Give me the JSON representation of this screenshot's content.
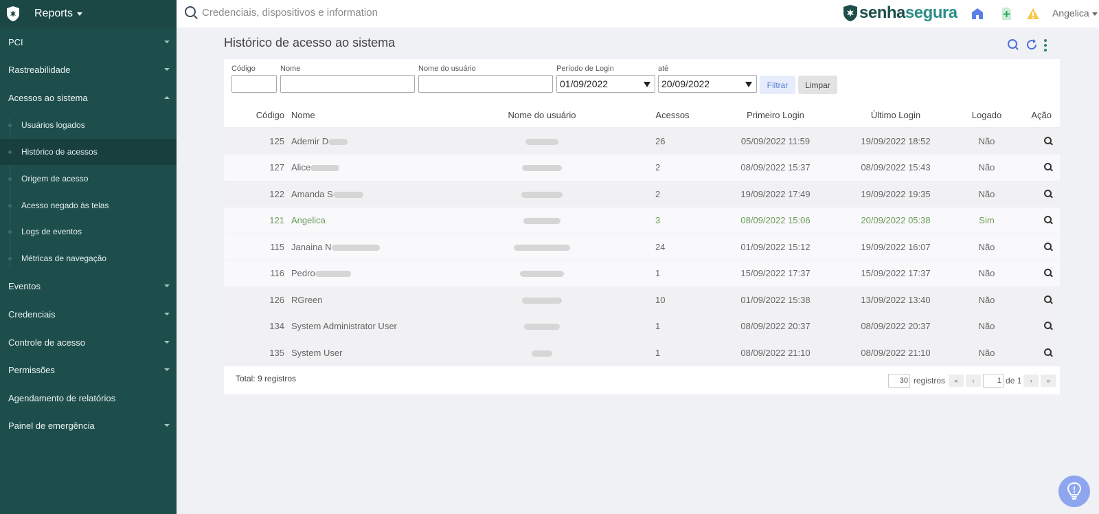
{
  "sidebar": {
    "title": "Reports",
    "menu": [
      {
        "label": "PCI"
      },
      {
        "label": "Rastreabilidade"
      },
      {
        "label": "Acessos ao sistema"
      },
      {
        "label": "Eventos"
      },
      {
        "label": "Credenciais"
      },
      {
        "label": "Controle de acesso"
      },
      {
        "label": "Permissões"
      },
      {
        "label": "Agendamento de relatórios"
      },
      {
        "label": "Painel de emergência"
      }
    ],
    "submenu": [
      {
        "label": "Usuários logados"
      },
      {
        "label": "Histórico de acessos"
      },
      {
        "label": "Origem de acesso"
      },
      {
        "label": "Acesso negado às telas"
      },
      {
        "label": "Logs de eventos"
      },
      {
        "label": "Métricas de navegação"
      }
    ]
  },
  "topbar": {
    "search_placeholder": "Credenciais, dispositivos e information",
    "brand_part1": "senha",
    "brand_part2": "segura",
    "user": "Angelica"
  },
  "page": {
    "title": "Histórico de acesso ao sistema"
  },
  "filters": {
    "code_label": "Código",
    "name_label": "Nome",
    "username_label": "Nome do usuário",
    "period_label": "Período de Login",
    "until_label": "até",
    "period_from": "01/09/2022",
    "period_to": "20/09/2022",
    "filter_button": "Filtrar",
    "clear_button": "Limpar"
  },
  "table": {
    "headers": {
      "code": "Código",
      "name": "Nome",
      "username": "Nome do usuário",
      "accesses": "Acessos",
      "first_login": "Primeiro Login",
      "last_login": "Último Login",
      "logged": "Logado",
      "action": "Ação"
    },
    "rows": [
      {
        "code": "125",
        "name": "Ademir D",
        "accesses": "26",
        "first": "05/09/2022 11:59",
        "last": "19/09/2022 18:52",
        "logged": "Não"
      },
      {
        "code": "127",
        "name": "Alice",
        "accesses": "2",
        "first": "08/09/2022 15:37",
        "last": "08/09/2022 15:43",
        "logged": "Não"
      },
      {
        "code": "122",
        "name": "Amanda S",
        "accesses": "2",
        "first": "19/09/2022 17:49",
        "last": "19/09/2022 19:35",
        "logged": "Não"
      },
      {
        "code": "121",
        "name": "Angelica",
        "accesses": "3",
        "first": "08/09/2022 15:06",
        "last": "20/09/2022 05:38",
        "logged": "Sim"
      },
      {
        "code": "115",
        "name": "Janaina N",
        "accesses": "24",
        "first": "01/09/2022 15:12",
        "last": "19/09/2022 16:07",
        "logged": "Não"
      },
      {
        "code": "116",
        "name": "Pedro",
        "accesses": "1",
        "first": "15/09/2022 17:37",
        "last": "15/09/2022 17:37",
        "logged": "Não"
      },
      {
        "code": "126",
        "name": "RGreen",
        "accesses": "10",
        "first": "01/09/2022 15:38",
        "last": "13/09/2022 13:40",
        "logged": "Não"
      },
      {
        "code": "134",
        "name": "System Administrator User",
        "accesses": "1",
        "first": "08/09/2022 20:37",
        "last": "08/09/2022 20:37",
        "logged": "Não"
      },
      {
        "code": "135",
        "name": "System User",
        "accesses": "1",
        "first": "08/09/2022 21:10",
        "last": "08/09/2022 21:10",
        "logged": "Não"
      }
    ]
  },
  "footer": {
    "total": "Total: 9 registros",
    "per_page": "30",
    "registros_label": "registros",
    "page": "1",
    "of_label": "de 1",
    "first_btn": "«",
    "prev_btn": "‹",
    "next_btn": "›",
    "last_btn": "»"
  },
  "colors": {
    "sidebar_bg": "#1e4e4b",
    "brand_dark": "#1e4e4b",
    "brand_accent": "#2c8f87",
    "highlight_row_text": "#6a9a59",
    "filter_button_text": "#5b7fd8"
  },
  "icons": [
    "shield-logo-icon",
    "search-icon",
    "home-icon",
    "add-document-icon",
    "warning-icon",
    "refresh-icon",
    "more-vertical-icon",
    "magnifier-icon",
    "lightbulb-icon"
  ]
}
